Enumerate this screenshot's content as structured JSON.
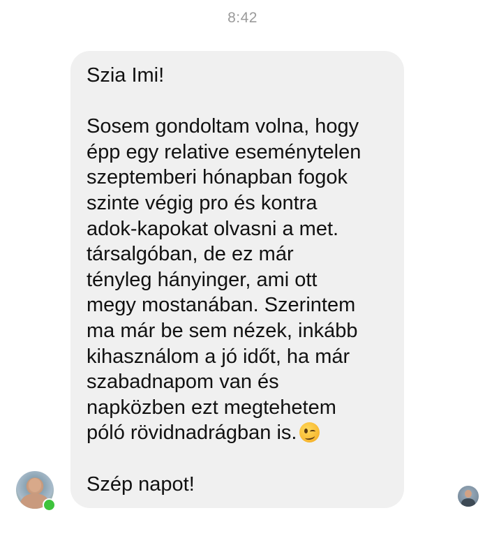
{
  "chat": {
    "timestamp": "8:42",
    "message": {
      "greeting": "Szia Imi!",
      "body": "Sosem gondoltam volna, hogy\népp egy relative eseménytelen\nszeptemberi hónapban fogok\nszinte végig pro és kontra\nadok-kapokat olvasni a met.\ntársalgóban, de ez már\ntényleg hányinger, ami ott\nmegy mostanában. Szerintem\nma már be sem nézek, inkább\nkihasználom a jó időt, ha már\nszabadnapom van és\nnapközben ezt megtehetem\npóló rövidnadrágban is.",
      "emoji": "winking-face-emoji",
      "closing": "Szép napot!"
    },
    "sender": {
      "avatar_icon": "user-photo-avatar",
      "status": "online",
      "status_color": "#3ec33c"
    },
    "seen_indicator": {
      "avatar_icon": "user-photo-avatar"
    },
    "colors": {
      "bubble": "#f0f0f0",
      "text": "#111111",
      "timestamp": "#9a9a9a"
    }
  }
}
